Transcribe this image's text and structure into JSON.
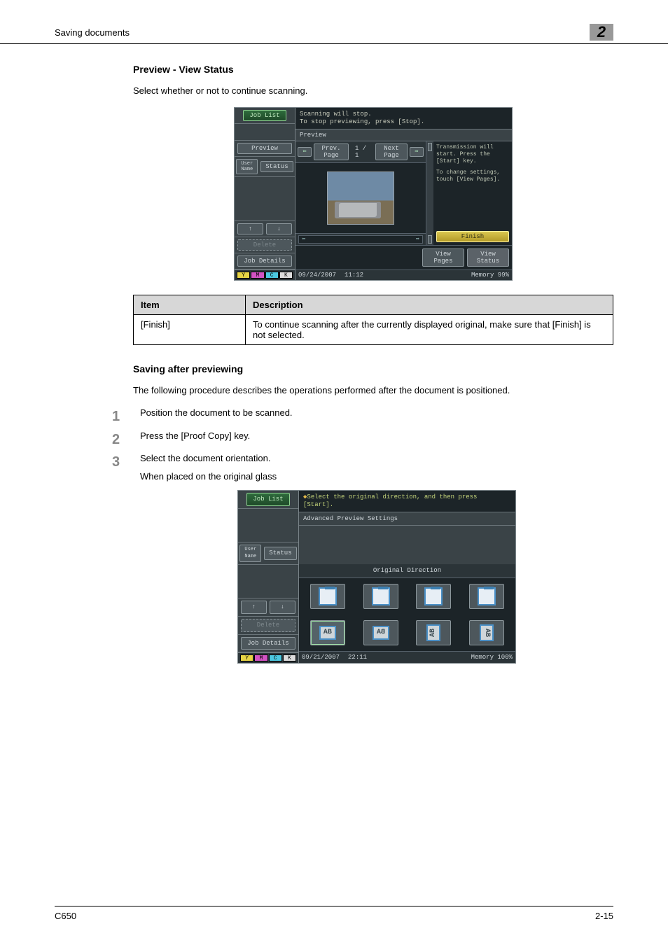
{
  "header": {
    "section_title": "Saving documents",
    "chapter_number": "2"
  },
  "sections": {
    "s1_title": "Preview - View Status",
    "s1_text": "Select whether or not to continue scanning.",
    "s2_title": "Saving after previewing",
    "s2_text": "The following procedure describes the operations performed after the document is positioned."
  },
  "panel1": {
    "job_list": "Job List",
    "preview_btn": "Preview",
    "user_name": "User Name",
    "status": "Status",
    "delete": "Delete",
    "job_details": "Job Details",
    "msg_line1": "Scanning will stop.",
    "msg_line2": "To stop previewing, press [Stop].",
    "titlebar": "Preview",
    "prev_page": "Prev. Page",
    "page_disp": "1 /   1",
    "next_page": "Next Page",
    "side_msg1": "Transmission will start. Press the [Start] key.",
    "side_msg2": "To change settings, touch [View Pages].",
    "finish": "Finish",
    "view_pages": "View Pages",
    "view_status": "View Status",
    "date": "09/24/2007",
    "time": "11:12",
    "memory_label": "Memory",
    "memory_value": "99%",
    "toner": {
      "y": "Y",
      "m": "M",
      "c": "C",
      "k": "K"
    }
  },
  "table": {
    "h1": "Item",
    "h2": "Description",
    "r1c1": "[Finish]",
    "r1c2": "To continue scanning after the currently displayed original, make sure that [Finish] is not selected."
  },
  "steps": {
    "s1": "Position the document to be scanned.",
    "s2": "Press the [Proof Copy] key.",
    "s3": "Select the document orientation.",
    "s3_sub": "When placed on the original glass"
  },
  "panel2": {
    "job_list": "Job List",
    "user_name": "User Name",
    "status": "Status",
    "delete": "Delete",
    "job_details": "Job Details",
    "top_msg": "Select the original direction, and then press [Start].",
    "adv_settings": "Advanced Preview Settings",
    "orig_dir": "Original Direction",
    "g1": "AB",
    "g2": "BA",
    "g3": "AB",
    "g4": "AB",
    "date": "09/21/2007",
    "time": "22:11",
    "memory_label": "Memory",
    "memory_value": "100%",
    "toner": {
      "y": "Y",
      "m": "M",
      "c": "C",
      "k": "K"
    }
  },
  "footer": {
    "left": "C650",
    "right": "2-15"
  }
}
